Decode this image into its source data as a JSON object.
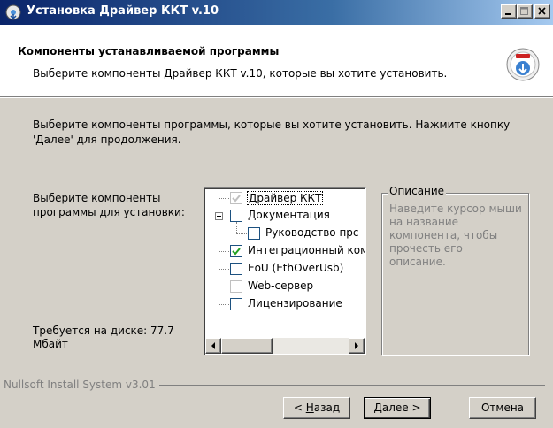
{
  "window": {
    "title": "Установка Драйвер ККТ v.10",
    "controls": [
      "minimize-icon",
      "maximize-icon",
      "close-icon"
    ]
  },
  "header": {
    "title": "Компоненты устанавливаемой программы",
    "subtitle": "Выберите компоненты Драйвер ККТ v.10, которые вы хотите установить.",
    "icon": "installer-disc-icon"
  },
  "intro": {
    "text": "Выберите компоненты программы, которые вы хотите установить. Нажмите кнопку 'Далее' для продолжения."
  },
  "choose_label": "Выберите компоненты программы для установки:",
  "space_required": "Требуется на диске: 77.7 Мбайт",
  "components": [
    {
      "label": "Драйвер ККТ",
      "checked": true,
      "disabled": true,
      "selected": true
    },
    {
      "label": "Документация",
      "checked": false,
      "expander": "minus"
    },
    {
      "label": "Руководство прс",
      "checked": false,
      "child": true
    },
    {
      "label": "Интеграционный ком",
      "checked": true
    },
    {
      "label": "EoU (EthOverUsb)",
      "checked": false
    },
    {
      "label": "Web-сервер",
      "checked": false,
      "disabled": true
    },
    {
      "label": "Лицензирование",
      "checked": false
    }
  ],
  "description": {
    "legend": "Описание",
    "text": "Наведите курсор мыши на название компонента, чтобы прочесть его описание."
  },
  "branding": "Nullsoft Install System v3.01",
  "buttons": {
    "back_prefix": "< ",
    "back_mnemonic": "Н",
    "back_rest": "азад",
    "next_mnemonic": "Д",
    "next_rest": "алее >",
    "cancel": "Отмена"
  },
  "colors": {
    "title_bar": "#0a246a",
    "checkmark": "#21a121",
    "face": "#d4d0c8"
  }
}
